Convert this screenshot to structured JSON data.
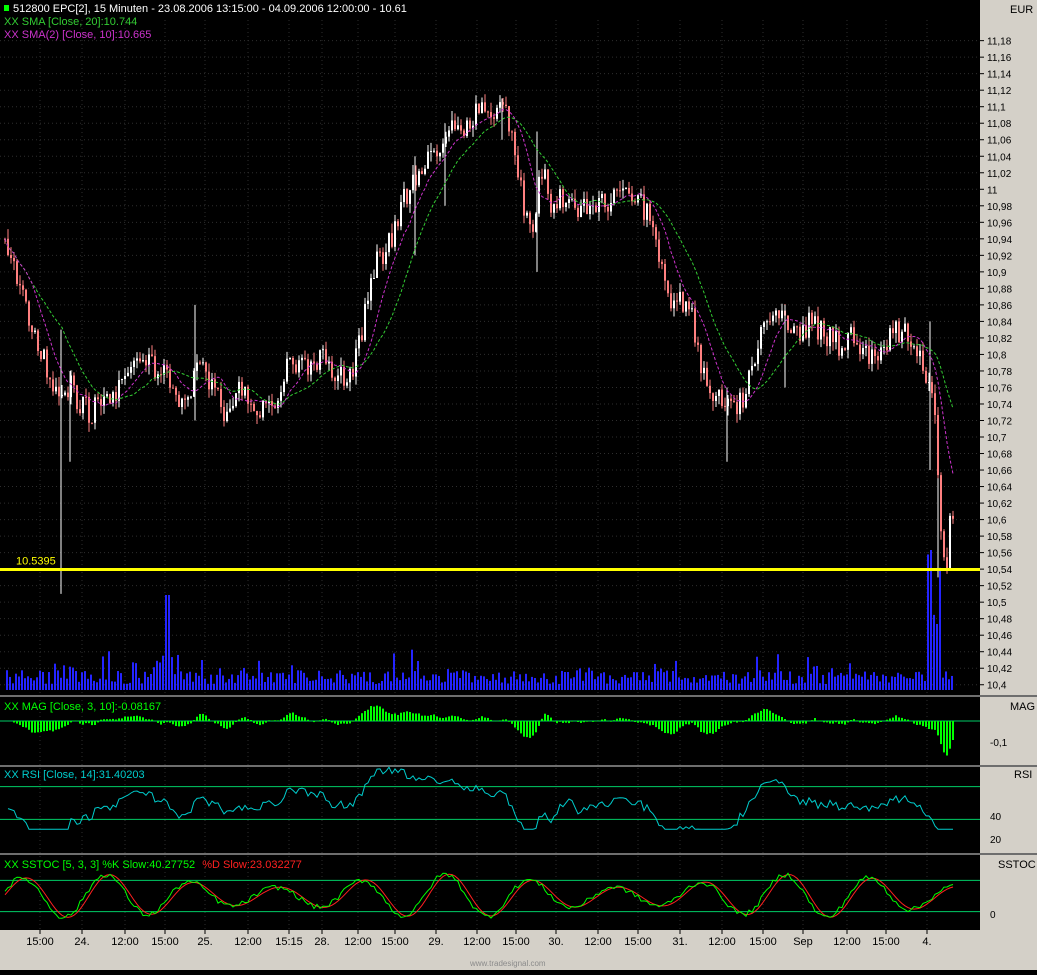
{
  "colors": {
    "background": "#000000",
    "axis_bg": "#d4d0c8",
    "grid": "#2e2e2e",
    "up_candle": "#ffffff",
    "down_candle": "#ff8080",
    "sma20": "#33cc33",
    "sma10": "#cc33cc",
    "support": "#ffff00",
    "volume": "#2424ff",
    "mag": "#00ff00",
    "rsi": "#00cccc",
    "stoch_k": "#00ff00",
    "stoch_d": "#ff2020",
    "panel_lines": "#00cc66"
  },
  "header": {
    "title": "512800  EPC[2], 15 Minuten - 23.08.2006 13:15:00 - 04.09.2006 12:00:00 - 10.61",
    "sma20_label": "XX SMA [Close, 20]:10.744",
    "sma10_label": "XX SMA(2) [Close, 10]:10.665",
    "currency": "EUR"
  },
  "support_label": "10.5395",
  "footer_watermark": "www.tradesignal.com",
  "chart_data": [
    {
      "type": "candlestick",
      "name": "512800 EPC[2], 15 Minuten",
      "ylim": [
        10.39,
        11.205
      ],
      "yticks": [
        "11,18",
        "11,16",
        "11,14",
        "11,12",
        "11,1",
        "11,08",
        "11,06",
        "11,04",
        "11,02",
        "11",
        "10,98",
        "10,96",
        "10,94",
        "10,92",
        "10,9",
        "10,88",
        "10,86",
        "10,84",
        "10,82",
        "10,8",
        "10,78",
        "10,76",
        "10,74",
        "10,72",
        "10,7",
        "10,68",
        "10,66",
        "10,64",
        "10,62",
        "10,6",
        "10,58",
        "10,56",
        "10,54",
        "10,52",
        "10,5",
        "10,48",
        "10,46",
        "10,44",
        "10,42",
        "10,4"
      ],
      "x_time_labels": [
        "15:00",
        "24.",
        "12:00",
        "15:00",
        "25.",
        "12:00",
        "15:15",
        "28.",
        "12:00",
        "15:00",
        "29.",
        "12:00",
        "15:00",
        "30.",
        "12:00",
        "15:00",
        "31.",
        "12:00",
        "15:00",
        "Sep",
        "12:00",
        "15:00",
        "4."
      ],
      "close_anchors": [
        [
          0,
          10.94
        ],
        [
          5,
          10.94
        ],
        [
          10,
          10.92
        ],
        [
          20,
          10.88
        ],
        [
          30,
          10.84
        ],
        [
          40,
          10.8
        ],
        [
          50,
          10.77
        ],
        [
          60,
          10.74
        ],
        [
          70,
          10.76
        ],
        [
          80,
          10.74
        ],
        [
          90,
          10.73
        ],
        [
          100,
          10.74
        ],
        [
          110,
          10.75
        ],
        [
          120,
          10.76
        ],
        [
          130,
          10.78
        ],
        [
          140,
          10.8
        ],
        [
          150,
          10.79
        ],
        [
          160,
          10.78
        ],
        [
          170,
          10.76
        ],
        [
          180,
          10.74
        ],
        [
          190,
          10.76
        ],
        [
          200,
          10.8
        ],
        [
          210,
          10.76
        ],
        [
          220,
          10.74
        ],
        [
          230,
          10.72
        ],
        [
          240,
          10.76
        ],
        [
          250,
          10.74
        ],
        [
          260,
          10.73
        ],
        [
          270,
          10.74
        ],
        [
          280,
          10.76
        ],
        [
          290,
          10.8
        ],
        [
          300,
          10.78
        ],
        [
          310,
          10.79
        ],
        [
          320,
          10.8
        ],
        [
          330,
          10.78
        ],
        [
          340,
          10.77
        ],
        [
          350,
          10.78
        ],
        [
          360,
          10.82
        ],
        [
          370,
          10.9
        ],
        [
          380,
          10.92
        ],
        [
          390,
          10.94
        ],
        [
          400,
          10.98
        ],
        [
          410,
          11.0
        ],
        [
          420,
          11.02
        ],
        [
          430,
          11.04
        ],
        [
          440,
          11.06
        ],
        [
          450,
          11.08
        ],
        [
          460,
          11.07
        ],
        [
          470,
          11.09
        ],
        [
          480,
          11.1
        ],
        [
          490,
          11.09
        ],
        [
          500,
          11.1
        ],
        [
          510,
          11.08
        ],
        [
          520,
          11.0
        ],
        [
          530,
          10.94
        ],
        [
          540,
          11.03
        ],
        [
          550,
          10.98
        ],
        [
          560,
          10.99
        ],
        [
          570,
          10.98
        ],
        [
          580,
          10.97
        ],
        [
          590,
          10.99
        ],
        [
          600,
          10.98
        ],
        [
          610,
          10.99
        ],
        [
          620,
          11.01
        ],
        [
          630,
          10.99
        ],
        [
          640,
          10.98
        ],
        [
          650,
          10.97
        ],
        [
          660,
          10.9
        ],
        [
          670,
          10.86
        ],
        [
          680,
          10.87
        ],
        [
          690,
          10.85
        ],
        [
          700,
          10.78
        ],
        [
          710,
          10.76
        ],
        [
          720,
          10.74
        ],
        [
          730,
          10.73
        ],
        [
          740,
          10.74
        ],
        [
          750,
          10.78
        ],
        [
          760,
          10.82
        ],
        [
          770,
          10.84
        ],
        [
          780,
          10.85
        ],
        [
          790,
          10.82
        ],
        [
          800,
          10.83
        ],
        [
          810,
          10.84
        ],
        [
          820,
          10.83
        ],
        [
          830,
          10.82
        ],
        [
          840,
          10.81
        ],
        [
          850,
          10.82
        ],
        [
          860,
          10.81
        ],
        [
          870,
          10.8
        ],
        [
          880,
          10.81
        ],
        [
          890,
          10.82
        ],
        [
          900,
          10.83
        ],
        [
          910,
          10.82
        ],
        [
          920,
          10.8
        ],
        [
          930,
          10.76
        ],
        [
          935,
          10.7
        ],
        [
          940,
          10.6
        ],
        [
          945,
          10.54
        ],
        [
          950,
          10.61
        ]
      ],
      "spikes": [
        {
          "x": 61,
          "low": 10.51,
          "high": 10.83
        },
        {
          "x": 70,
          "low": 10.67,
          "high": 10.78
        },
        {
          "x": 195,
          "low": 10.72,
          "high": 10.86
        },
        {
          "x": 415,
          "low": 10.92,
          "high": 11.04
        },
        {
          "x": 445,
          "low": 10.98,
          "high": 11.08
        },
        {
          "x": 502,
          "low": 11.06,
          "high": 11.11
        },
        {
          "x": 537,
          "low": 10.9,
          "high": 11.07
        },
        {
          "x": 727,
          "low": 10.67,
          "high": 10.76
        },
        {
          "x": 785,
          "low": 10.76,
          "high": 10.86
        },
        {
          "x": 930,
          "low": 10.66,
          "high": 10.84
        },
        {
          "x": 938,
          "low": 10.53,
          "high": 10.65
        }
      ],
      "support_level": 10.5395
    },
    {
      "type": "line",
      "name": "XX MAG [Close, 3, 10]",
      "last_value": -0.08167,
      "yticks": [
        "-0,1"
      ]
    },
    {
      "type": "line",
      "name": "XX RSI [Close, 14]",
      "last_value": 31.40203,
      "yticks": [
        "40",
        "20"
      ]
    },
    {
      "type": "line",
      "name": "XX SSTOC [5, 3, 3]",
      "series": [
        {
          "name": "%K Slow",
          "last_value": 40.27752
        },
        {
          "name": "%D Slow",
          "last_value": 23.032277
        }
      ],
      "yticks": [
        "0"
      ]
    }
  ],
  "panels": {
    "mag_label": "XX MAG [Close, 3, 10]:-0.08167",
    "mag_axis_title": "MAG",
    "rsi_label": "XX RSI [Close, 14]:31.40203",
    "rsi_axis_title": "RSI",
    "sstoc_label_main": "XX SSTOC [5, 3, 3] %K Slow:40.27752",
    "sstoc_label_d": "%D Slow:23.032277",
    "sstoc_axis_title": "SSTOC"
  }
}
